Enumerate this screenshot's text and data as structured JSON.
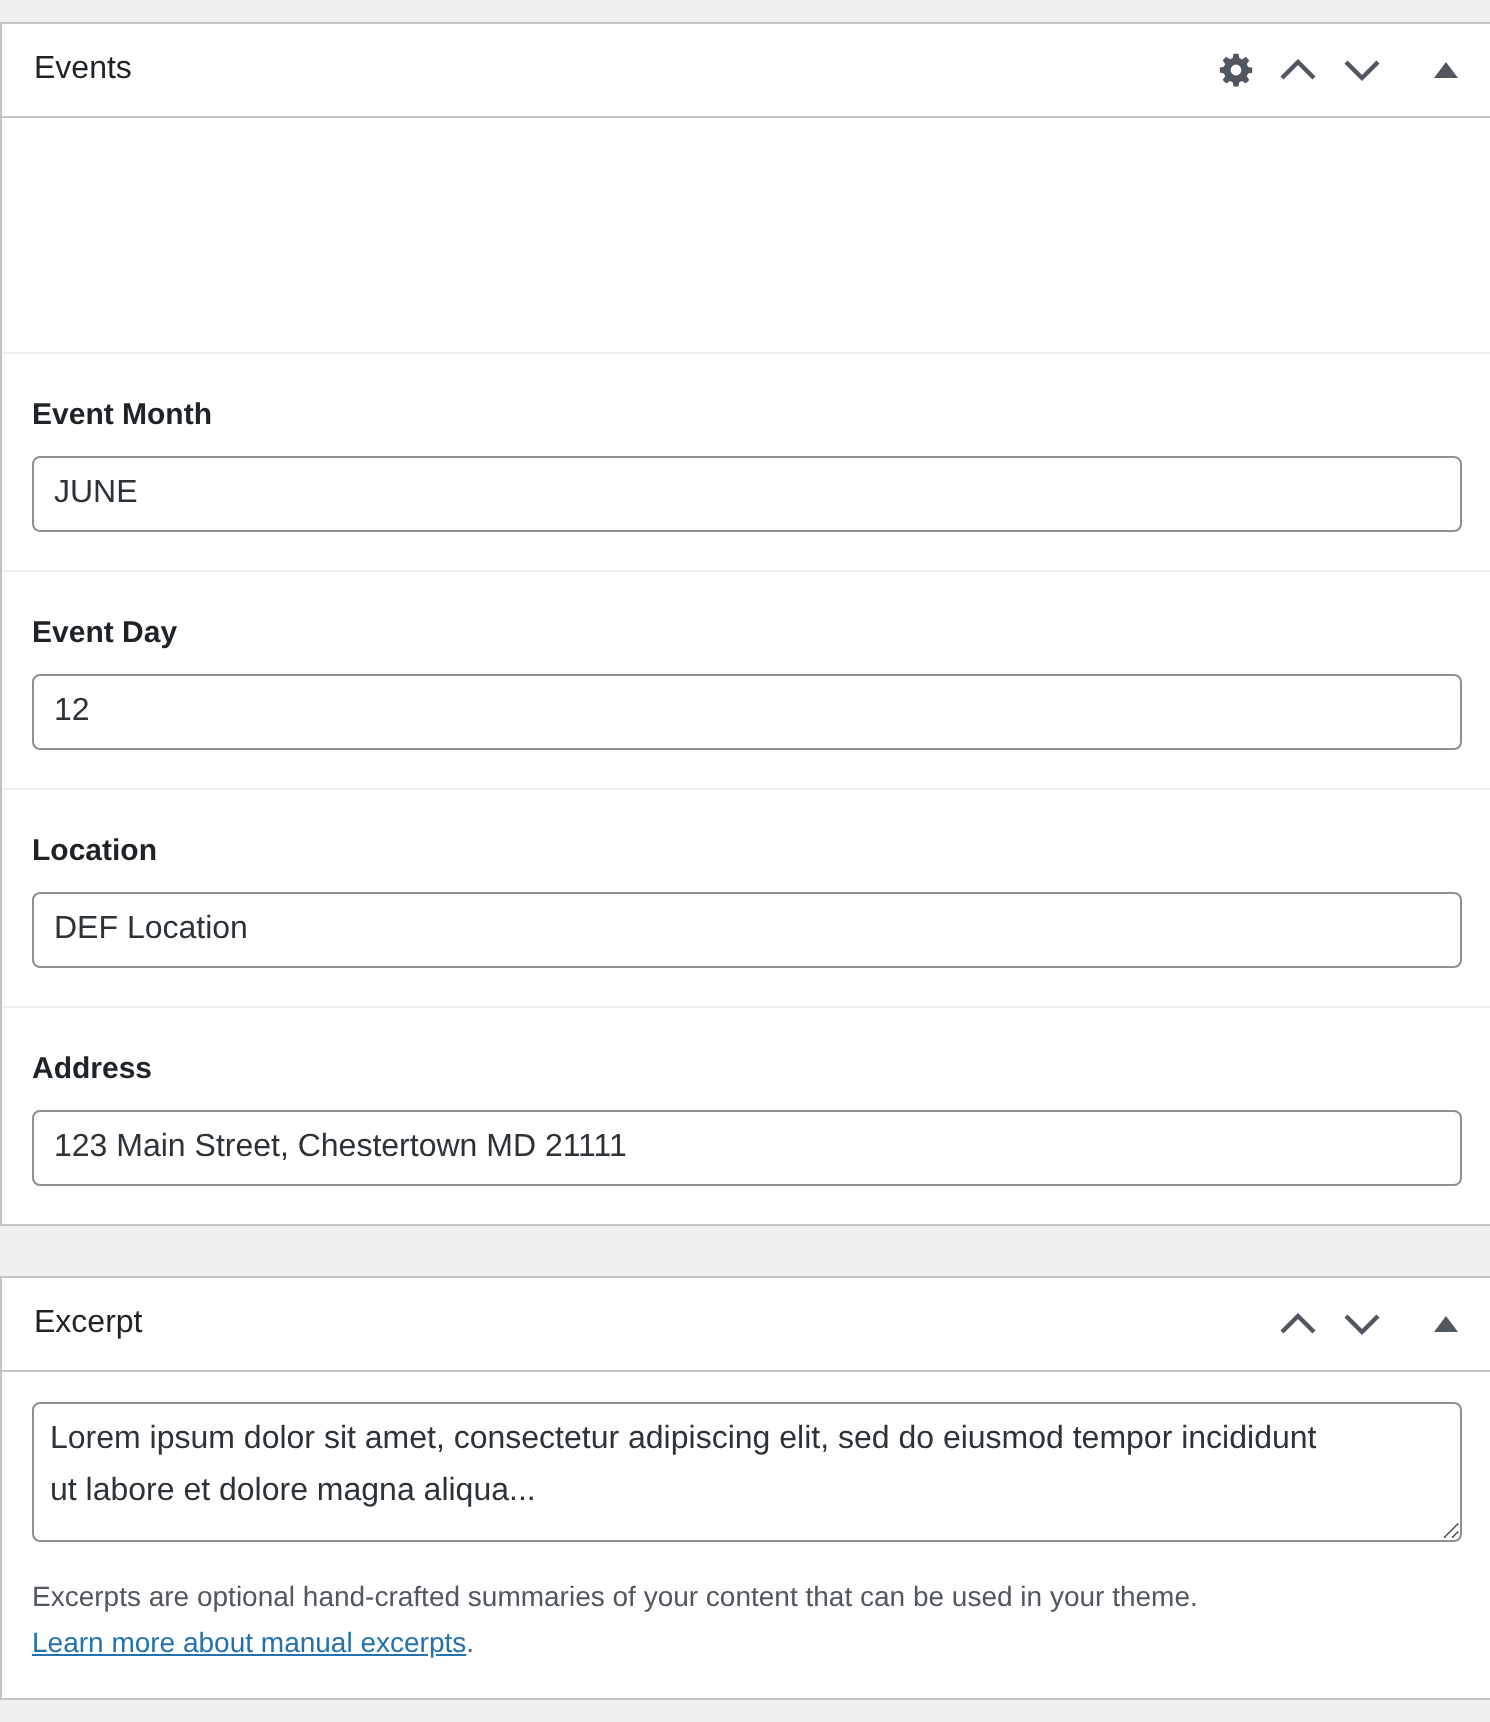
{
  "events": {
    "title": "Events",
    "settings": true,
    "fields": [
      {
        "label": "Event Month",
        "value": "JUNE"
      },
      {
        "label": "Event Day",
        "value": "12"
      },
      {
        "label": "Location",
        "value": "DEF Location"
      },
      {
        "label": "Address",
        "value": "123 Main Street, Chestertown MD 21111"
      }
    ]
  },
  "excerpt": {
    "title": "Excerpt",
    "settings": false,
    "value": "Lorem ipsum dolor sit amet, consectetur adipiscing elit, sed do eiusmod tempor incididunt ut labore et dolore magna aliqua...",
    "help": "Excerpts are optional hand-crafted summaries of your content that can be used in your theme.",
    "link": "Learn more about manual excerpts",
    "help_end": "."
  }
}
